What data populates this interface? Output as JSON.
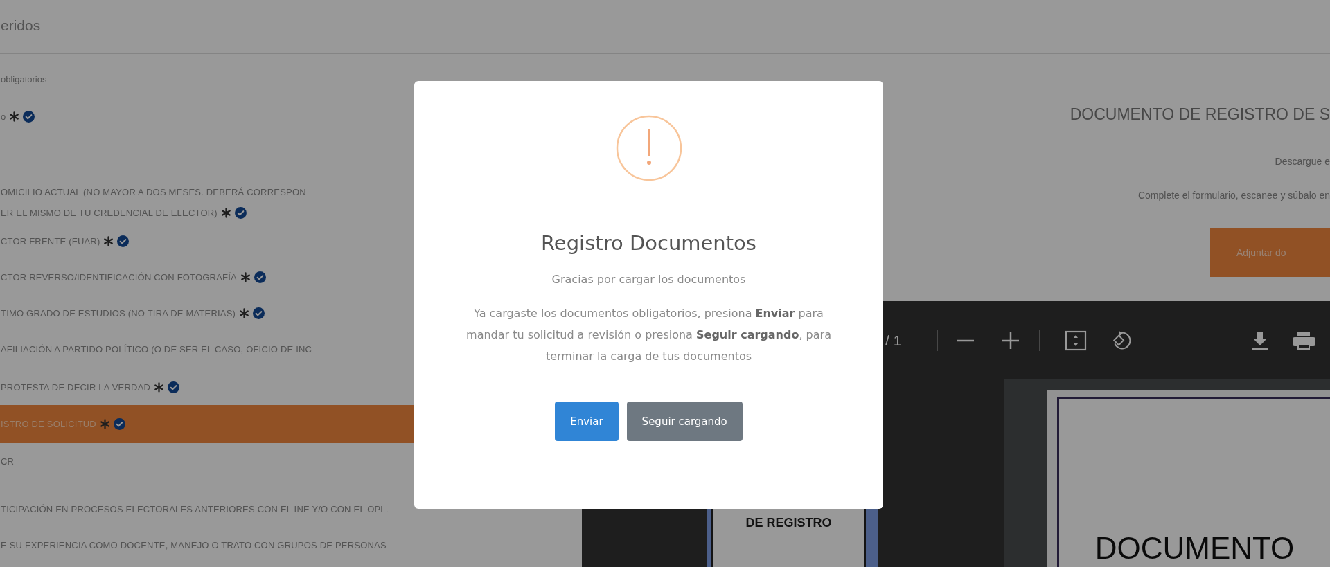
{
  "header": {
    "title": "eridos"
  },
  "section_label": "obligatorios",
  "documents": [
    {
      "lines": [
        "o"
      ],
      "required": true,
      "uploaded": true,
      "selected": false
    },
    {
      "lines": [
        "OMICILIO ACTUAL (NO MAYOR A DOS MESES. DEBERÁ CORRESPON",
        "ER EL MISMO DE TU CREDENCIAL DE ELECTOR)"
      ],
      "required": true,
      "uploaded": true,
      "selected": false
    },
    {
      "lines": [
        "CTOR FRENTE (FUAR)"
      ],
      "required": true,
      "uploaded": true,
      "selected": false
    },
    {
      "lines": [
        "CTOR REVERSO/IDENTIFICACIÓN CON FOTOGRAFÍA"
      ],
      "required": true,
      "uploaded": true,
      "selected": false
    },
    {
      "lines": [
        "TIMO GRADO DE ESTUDIOS (NO TIRA DE MATERIAS)"
      ],
      "required": true,
      "uploaded": true,
      "selected": false
    },
    {
      "lines": [
        "AFILIACIÓN A PARTIDO POLÍTICO (O DE SER EL CASO, OFICIO DE INC"
      ],
      "required": false,
      "uploaded": false,
      "selected": false
    },
    {
      "lines": [
        "PROTESTA DE DECIR LA VERDAD"
      ],
      "required": true,
      "uploaded": true,
      "selected": false
    },
    {
      "lines": [
        "ISTRO DE SOLICITUD"
      ],
      "required": true,
      "uploaded": true,
      "selected": true
    },
    {
      "lines": [
        "CR"
      ],
      "required": false,
      "uploaded": false,
      "selected": false
    },
    {
      "lines": [
        "TICIPACIÓN EN PROCESOS ELECTORALES ANTERIORES CON EL INE Y/O CON EL OPL."
      ],
      "required": false,
      "uploaded": false,
      "selected": false
    },
    {
      "lines": [
        "E SU EXPERIENCIA COMO DOCENTE, MANEJO O TRATO CON GRUPOS DE PERSONAS"
      ],
      "required": false,
      "uploaded": false,
      "selected": false
    }
  ],
  "instructions": {
    "title": "DOCUMENTO DE REGISTRO DE S",
    "lines": [
      "Descargue e",
      "Complete el formulario, escanee y súbalo en"
    ],
    "attach_button": "Adjuntar do"
  },
  "pdf_viewer": {
    "page_indicator": "/ 1",
    "thumbnail_text": "DE REGISTRO",
    "page_text": "DOCUMENTO"
  },
  "dialog": {
    "title": "Registro Documentos",
    "subtitle": "Gracias por cargar los documentos",
    "message": "Ya cargaste los documentos obligatorios, presiona **Enviar** para mandar tu solicitud a revisión o presiona **Seguir cargando**, para terminar la carga de tus documentos",
    "buttons": [
      {
        "label": "Enviar",
        "kind": "confirm"
      },
      {
        "label": "Seguir cargando",
        "kind": "cancel"
      }
    ]
  }
}
